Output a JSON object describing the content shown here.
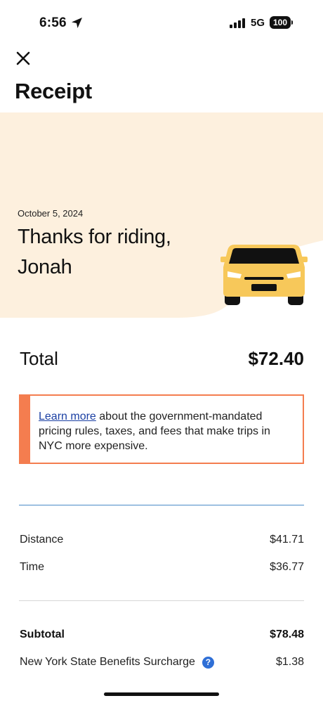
{
  "status_bar": {
    "time": "6:56",
    "network": "5G",
    "battery": "100"
  },
  "header": {
    "title": "Receipt"
  },
  "banner": {
    "date": "October 5, 2024",
    "heading": "Thanks for riding, Jonah"
  },
  "total": {
    "label": "Total",
    "value": "$72.40"
  },
  "notice": {
    "link_text": "Learn more",
    "text": " about the government-mandated pricing rules, taxes, and fees that make trips in NYC more expensive."
  },
  "fare": {
    "distance": {
      "label": "Distance",
      "value": "$41.71"
    },
    "time": {
      "label": "Time",
      "value": "$36.77"
    },
    "subtotal": {
      "label": "Subtotal",
      "value": "$78.48"
    },
    "surcharge": {
      "label": "New York State Benefits Surcharge",
      "value": "$1.38"
    }
  },
  "colors": {
    "banner_bg": "#fdf0de",
    "notice_accent": "#f47d4f",
    "car_yellow": "#f7c85a",
    "link": "#1a3fa3",
    "info": "#2f6fd6"
  }
}
